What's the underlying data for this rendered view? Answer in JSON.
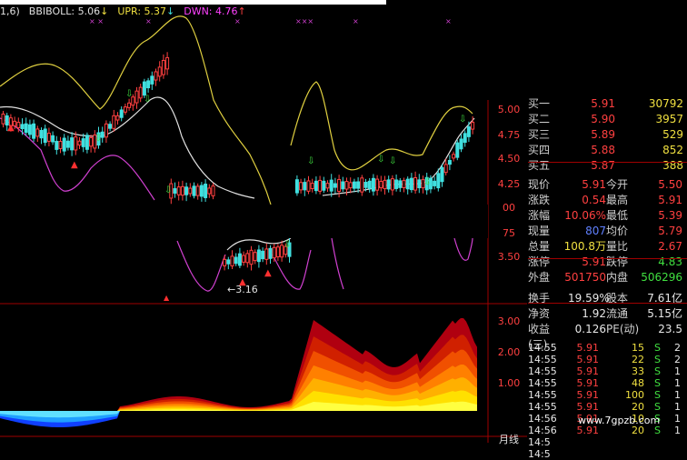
{
  "header": {
    "prefix": "1,6)",
    "boll_label": "BBIBOLL: 5.06",
    "boll_arrow": "↓",
    "upr_label": "UPR: 5.37",
    "upr_arrow": "↓",
    "dwn_label": "DWN: 4.76",
    "dwn_arrow": "↑"
  },
  "price_ticks": [
    "5.00",
    "4.75",
    "4.50",
    "4.25",
    "00",
    "75",
    "3.50"
  ],
  "indicator_ticks": [
    "3.00",
    "2.00",
    "1.00"
  ],
  "low_marker": "←3.16",
  "bottom_label": "月线",
  "order_book": [
    {
      "label": "买一",
      "price": "5.91",
      "vol": "30792"
    },
    {
      "label": "买二",
      "price": "5.90",
      "vol": "3957"
    },
    {
      "label": "买三",
      "price": "5.89",
      "vol": "529"
    },
    {
      "label": "买四",
      "price": "5.88",
      "vol": "852"
    },
    {
      "label": "买五",
      "price": "5.87",
      "vol": "388"
    }
  ],
  "quote": [
    {
      "l1": "现价",
      "v1": "5.91",
      "c1": "red",
      "l2": "今开",
      "v2": "5.50",
      "c2": "red"
    },
    {
      "l1": "涨跌",
      "v1": "0.54",
      "c1": "red",
      "l2": "最高",
      "v2": "5.91",
      "c2": "red"
    },
    {
      "l1": "涨幅",
      "v1": "10.06%",
      "c1": "red",
      "l2": "最低",
      "v2": "5.39",
      "c2": "red"
    },
    {
      "l1": "现量",
      "v1": "807",
      "c1": "blu",
      "l2": "均价",
      "v2": "5.79",
      "c2": "red"
    },
    {
      "l1": "总量",
      "v1": "100.8万",
      "c1": "yel",
      "l2": "量比",
      "v2": "2.67",
      "c2": "red"
    },
    {
      "l1": "涨停",
      "v1": "5.91",
      "c1": "red",
      "l2": "跌停",
      "v2": "4.83",
      "c2": "grn"
    },
    {
      "l1": "外盘",
      "v1": "501750",
      "c1": "red",
      "l2": "内盘",
      "v2": "506296",
      "c2": "grn"
    }
  ],
  "fundamentals": [
    {
      "l1": "换手",
      "v1": "19.59%",
      "l2": "股本",
      "v2": "7.61亿"
    },
    {
      "l1": "净资",
      "v1": "1.92",
      "l2": "流通",
      "v2": "5.15亿"
    },
    {
      "l1": "收益(三)",
      "v1": "0.126",
      "l2": "PE(动)",
      "v2": "23.5"
    }
  ],
  "ticks": [
    {
      "time": "14:55",
      "price": "5.91",
      "vol": "15",
      "side": "S",
      "n": "2"
    },
    {
      "time": "14:55",
      "price": "5.91",
      "vol": "22",
      "side": "S",
      "n": "2"
    },
    {
      "time": "14:55",
      "price": "5.91",
      "vol": "33",
      "side": "S",
      "n": "1"
    },
    {
      "time": "14:55",
      "price": "5.91",
      "vol": "48",
      "side": "S",
      "n": "1"
    },
    {
      "time": "14:55",
      "price": "5.91",
      "vol": "100",
      "side": "S",
      "n": "1"
    },
    {
      "time": "14:55",
      "price": "5.91",
      "vol": "20",
      "side": "S",
      "n": "1"
    },
    {
      "time": "14:56",
      "price": "5.91",
      "vol": "10",
      "side": "S",
      "n": "1"
    },
    {
      "time": "14:56",
      "price": "5.91",
      "vol": "20",
      "side": "S",
      "n": "1"
    },
    {
      "time": "14:5",
      "price": "",
      "vol": "",
      "side": "",
      "n": ""
    },
    {
      "time": "14:5",
      "price": "",
      "vol": "",
      "side": "",
      "n": ""
    }
  ],
  "watermark": "www.7gpzb.com",
  "colors": {
    "up": "#ff4040",
    "down": "#40e0e0",
    "grid": "#a00000",
    "upr": "#e0d040",
    "dwn": "#d040d0",
    "mid": "#e0e0e0"
  }
}
